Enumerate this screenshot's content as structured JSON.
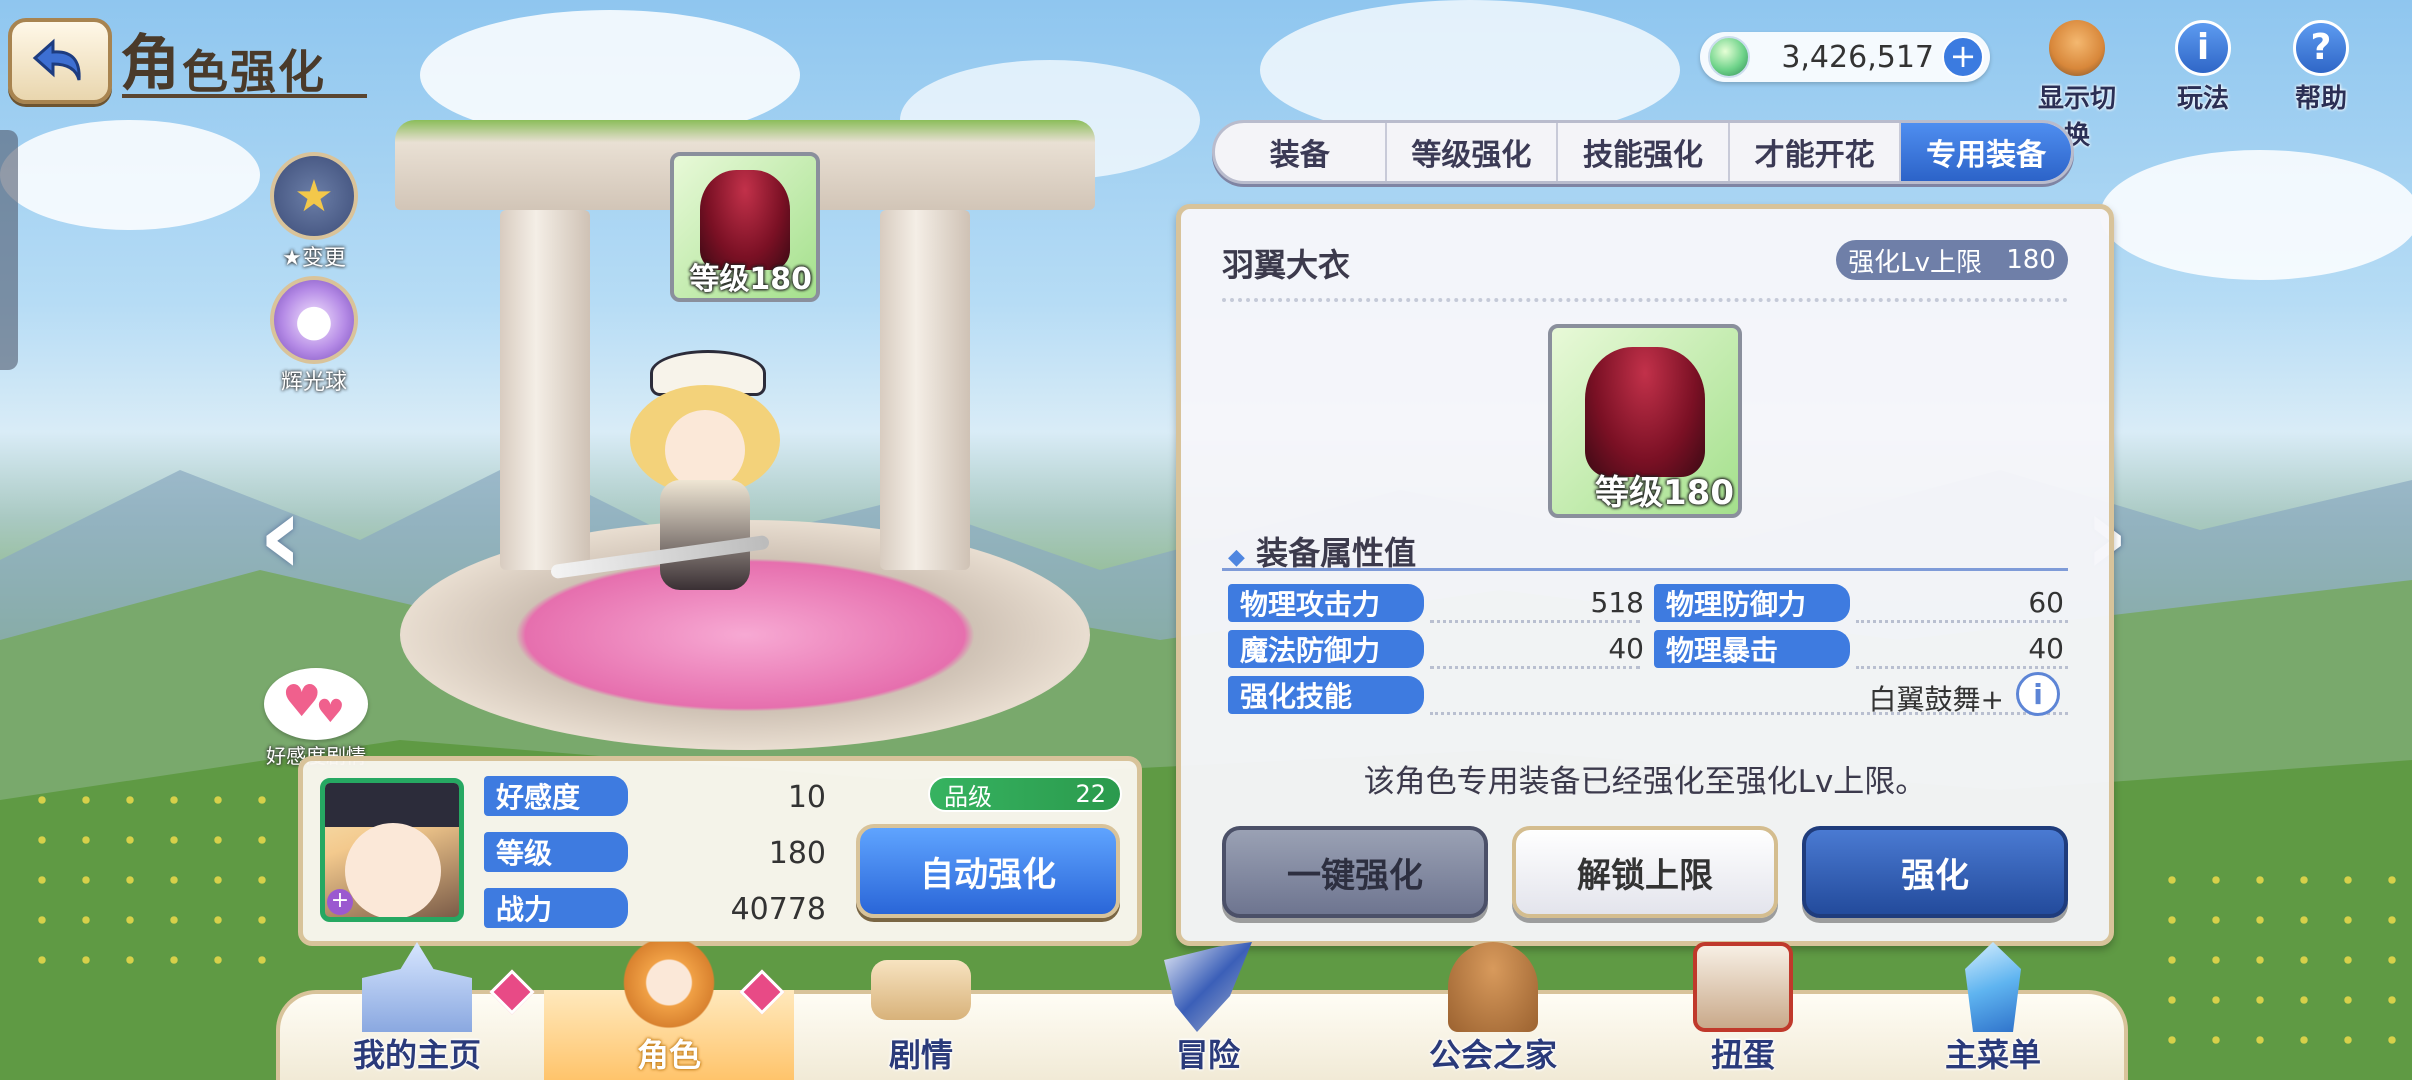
{
  "header": {
    "title_big": "角",
    "title_rest": "色强化"
  },
  "currency": {
    "value": "3,426,517",
    "plus": "+"
  },
  "top_actions": [
    {
      "label": "显示切换",
      "icon": "character-switch-icon"
    },
    {
      "label": "玩法",
      "icon": "info-icon"
    },
    {
      "label": "帮助",
      "icon": "help-icon"
    }
  ],
  "side_buttons": [
    {
      "label": "★变更",
      "icon": "star-change-icon"
    },
    {
      "label": "辉光球",
      "icon": "glow-orb-icon"
    }
  ],
  "stage_equip": {
    "level": "等级180"
  },
  "tabs": [
    {
      "label": "装备",
      "active": false
    },
    {
      "label": "等级强化",
      "active": false
    },
    {
      "label": "技能强化",
      "active": false
    },
    {
      "label": "才能开花",
      "active": false
    },
    {
      "label": "专用装备",
      "active": true
    }
  ],
  "equipment": {
    "name": "羽翼大衣",
    "cap_label": "强化Lv上限",
    "cap_value": "180",
    "level": "等级180",
    "section_title": "装备属性值",
    "stats": [
      {
        "label": "物理攻击力",
        "value": "518"
      },
      {
        "label": "物理防御力",
        "value": "60"
      },
      {
        "label": "魔法防御力",
        "value": "40"
      },
      {
        "label": "物理暴击",
        "value": "40"
      }
    ],
    "skill_label": "强化技能",
    "skill_value": "白翼鼓舞+",
    "skill_info": "i",
    "message": "该角色专用装备已经强化至强化Lv上限。",
    "buttons": {
      "one_click": "一键强化",
      "unlock": "解锁上限",
      "enhance": "强化"
    }
  },
  "character": {
    "affinity_story": "好感度剧情",
    "affinity_label": "好感度",
    "affinity_value": "10",
    "level_label": "等级",
    "level_value": "180",
    "power_label": "战力",
    "power_value": "40778",
    "grade_label": "品级",
    "grade_value": "22",
    "auto_button": "自动强化"
  },
  "bottom_nav": [
    {
      "label": "我的主页",
      "active": false,
      "badge": true
    },
    {
      "label": "角色",
      "active": true,
      "badge": true
    },
    {
      "label": "剧情",
      "active": false,
      "badge": false
    },
    {
      "label": "冒险",
      "active": false,
      "badge": false
    },
    {
      "label": "公会之家",
      "active": false,
      "badge": false
    },
    {
      "label": "扭蛋",
      "active": false,
      "badge": false
    },
    {
      "label": "主菜单",
      "active": false,
      "badge": false
    }
  ],
  "colors": {
    "accent_blue": "#3e7be0",
    "gold_border": "#d8c39a",
    "badge_pink": "#e84a86",
    "grade_green": "#2b9a4d"
  }
}
